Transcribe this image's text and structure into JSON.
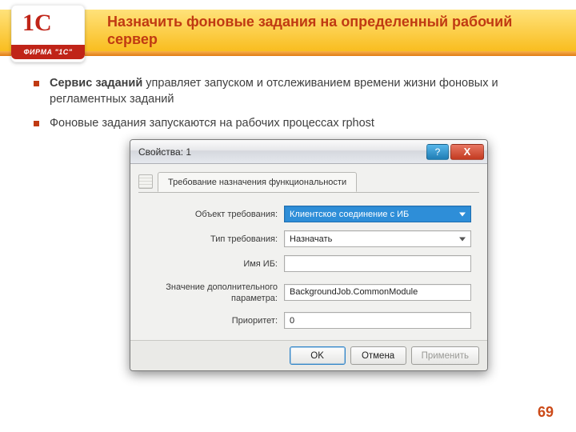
{
  "brand": {
    "logo_mark": "1C",
    "logo_sub": "ФИРМА \"1С\""
  },
  "title": "Назначить фоновые задания на определенный рабочий сервер",
  "bullets": [
    {
      "strong": "Сервис заданий",
      "rest": " управляет запуском и отслеживанием времени жизни фоновых и регламентных заданий"
    },
    {
      "strong": "",
      "rest": "Фоновые задания запускаются на рабочих процессах rphost"
    }
  ],
  "dialog": {
    "title": "Свойства: 1",
    "help_glyph": "?",
    "close_glyph": "X",
    "tab_label": "Требование назначения функциональности",
    "fields": {
      "object_label": "Объект требования:",
      "object_value": "Клиентское соединение с ИБ",
      "type_label": "Тип требования:",
      "type_value": "Назначать",
      "ibname_label": "Имя ИБ:",
      "ibname_value": "",
      "param_label": "Значение дополнительного параметра:",
      "param_value": "BackgroundJob.CommonModule",
      "priority_label": "Приоритет:",
      "priority_value": "0"
    },
    "buttons": {
      "ok": "OK",
      "cancel": "Отмена",
      "apply": "Применить"
    }
  },
  "page_number": "69"
}
